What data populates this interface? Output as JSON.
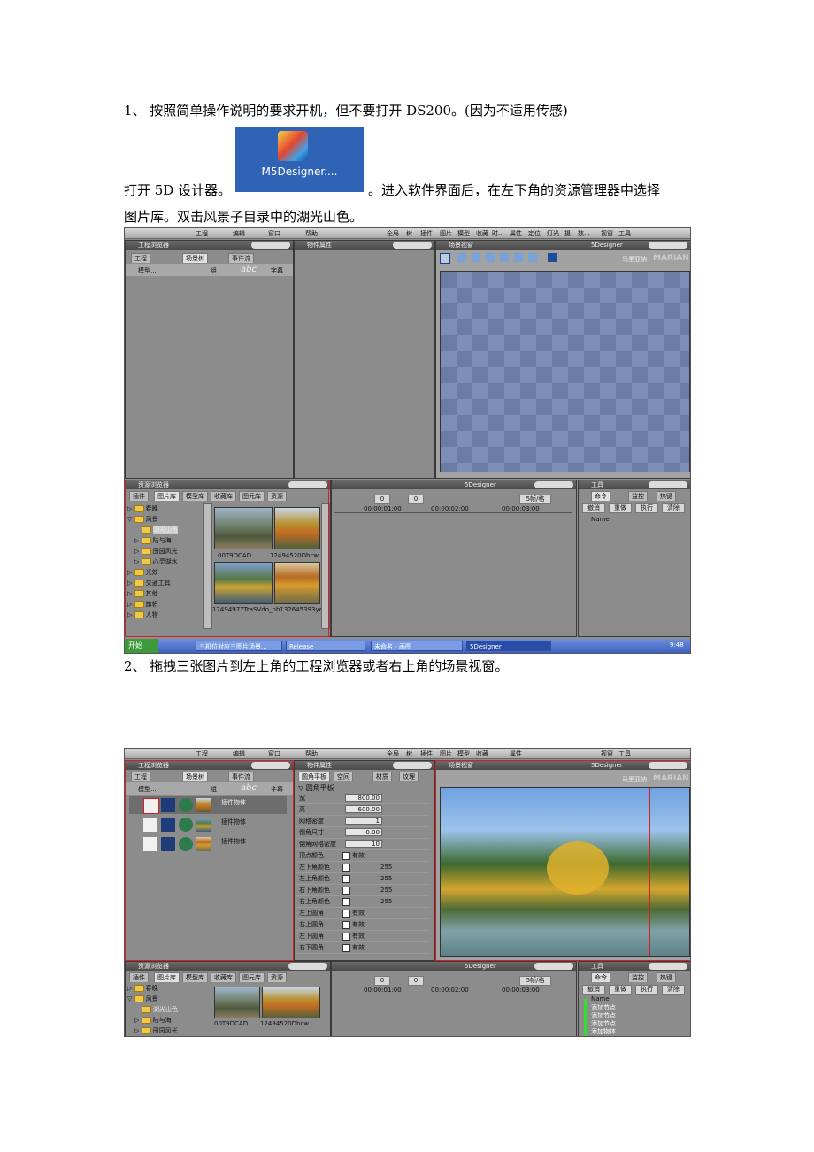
{
  "step1": {
    "text": "1、 按照简单操作说明的要求开机，但不要打开 DS200。(因为不适用传感)",
    "line2_before": "打开 5D 设计器。",
    "line2_after": "。进入软件界面后，在左下角的资源管理器中选择",
    "line3": "图片库。双击风景子目录中的湖光山色。"
  },
  "desktop_icon": {
    "label": "M5Designer...."
  },
  "step2": {
    "text": "2、 拖拽三张图片到左上角的工程浏览器或者右上角的场景视窗。"
  },
  "app": {
    "menu": [
      "工程",
      "编辑",
      "窗口",
      "帮助"
    ],
    "toolbar_tabs": [
      "全局",
      "树",
      "插件",
      "图片",
      "模型",
      "收藏",
      "时...",
      "属性",
      "定位",
      "灯光",
      "摄",
      "数...",
      "视窗",
      "工具"
    ],
    "project_browser": {
      "title": "工程浏览器",
      "tabs": [
        "工程",
        "场景树",
        "事件流"
      ],
      "toolbar": [
        "模型...",
        "组",
        "abc",
        "字幕"
      ]
    },
    "object_props": {
      "title": "物件属性"
    },
    "scene_view": {
      "title": "场景视窗",
      "right_title": "5Designer",
      "labels": [
        "马里亚纳",
        "MARIAN"
      ]
    },
    "resource_manager": {
      "title": "资源浏览器",
      "tabs": [
        "插件",
        "图片库",
        "模型库",
        "收藏库",
        "图元库",
        "资源"
      ],
      "tree": [
        "春晚",
        "风景",
        "湖光山色",
        "陆与海",
        "田园风光",
        "心灵湖水",
        "光效",
        "交通工具",
        "其他",
        "旗帜",
        "人物"
      ],
      "thumb_labels": [
        "00T9DCAD",
        "12494520Dbcw",
        "12494977TraSVdo_ph132645393yeZcI"
      ]
    },
    "timeline": {
      "title": "5Designer",
      "frame_a": "0",
      "frame_b": "0",
      "fps": "5帧/格",
      "times": [
        "00:00:01:00",
        "00:00:02:00",
        "00:00:03:00"
      ]
    },
    "tools": {
      "title": "工具",
      "tabs": [
        "命令",
        "监控",
        "热键"
      ],
      "buttons": [
        "撤消",
        "重做",
        "执行",
        "清除"
      ],
      "col_header": "Name",
      "log": [
        "添加节点",
        "添加节点",
        "添加节点",
        "添加物体"
      ]
    },
    "taskbar": {
      "start": "开始",
      "items": [
        "三机位对应三图片场景...",
        "Release",
        "未命名 - 画图",
        "5Designer"
      ],
      "clock": "9:48"
    }
  },
  "screen2": {
    "scene_items": [
      "插件物体",
      "插件物体",
      "插件物体"
    ],
    "props_tabs": [
      "圆角平板",
      "空间",
      "材质",
      "纹理"
    ],
    "props_header": "圆角平板",
    "props": [
      {
        "label": "宽",
        "value": "800.00"
      },
      {
        "label": "高",
        "value": "600.00"
      },
      {
        "label": "网格密度",
        "value": "1"
      },
      {
        "label": "倒角尺寸",
        "value": "0.00"
      },
      {
        "label": "倒角网格密度",
        "value": "10"
      }
    ],
    "checks": [
      {
        "label": "顶点颜色",
        "text": "有效"
      },
      {
        "label": "左下角颜色",
        "text": "255"
      },
      {
        "label": "左上角颜色",
        "text": "255"
      },
      {
        "label": "右下角颜色",
        "text": "255"
      },
      {
        "label": "右上角颜色",
        "text": "255"
      },
      {
        "label": "左上圆角",
        "text": "有效"
      },
      {
        "label": "右上圆角",
        "text": "有效"
      },
      {
        "label": "左下圆角",
        "text": "有效"
      },
      {
        "label": "右下圆角",
        "text": "有效"
      }
    ]
  }
}
